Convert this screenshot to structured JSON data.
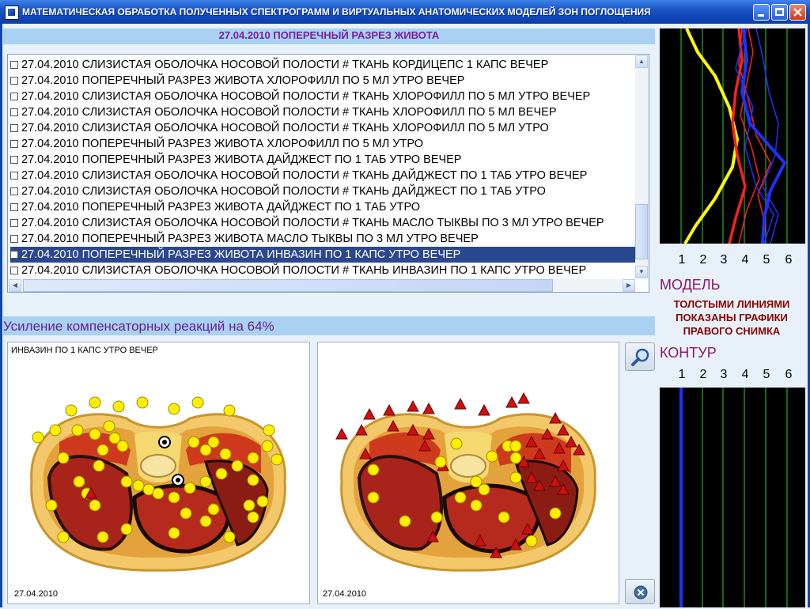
{
  "window": {
    "title": "МАТЕМАТИЧЕСКАЯ ОБРАБОТКА ПОЛУЧЕННЫХ СПЕКТРОГРАММ И ВИРТУАЛЬНЫХ АНАТОМИЧЕСКИХ МОДЕЛЕЙ ЗОН ПОГЛОЩЕНИЯ"
  },
  "header": {
    "title": "27.04.2010 ПОПЕРЕЧНЫЙ РАЗРЕЗ ЖИВОТА"
  },
  "list": {
    "items": [
      {
        "text": "27.04.2010  СЛИЗИСТАЯ  ОБОЛОЧКА  НОСОВОЙ  ПОЛОСТИ # ТКАНЬ  КОРДИЦЕПС 1 КАПС   ВЕЧЕР",
        "checked": false,
        "selected": false
      },
      {
        "text": "27.04.2010  ПОПЕРЕЧНЫЙ  РАЗРЕЗ ЖИВОТА  ХЛОРОФИЛЛ ПО 5 МЛ УТРО ВЕЧЕР",
        "checked": false,
        "selected": false
      },
      {
        "text": "27.04.2010  СЛИЗИСТАЯ  ОБОЛОЧКА  НОСОВОЙ  ПОЛОСТИ # ТКАНЬ  ХЛОРОФИЛЛ ПО 5 МЛ УТРО ВЕЧЕР",
        "checked": false,
        "selected": false
      },
      {
        "text": "27.04.2010  СЛИЗИСТАЯ  ОБОЛОЧКА  НОСОВОЙ  ПОЛОСТИ # ТКАНЬ  ХЛОРОФИЛЛ ПО 5 МЛ   ВЕЧЕР",
        "checked": false,
        "selected": false
      },
      {
        "text": "27.04.2010  СЛИЗИСТАЯ  ОБОЛОЧКА  НОСОВОЙ  ПОЛОСТИ # ТКАНЬ  ХЛОРОФИЛЛ ПО 5 МЛ УТРО",
        "checked": false,
        "selected": false
      },
      {
        "text": "27.04.2010  ПОПЕРЕЧНЫЙ  РАЗРЕЗ ЖИВОТА  ХЛОРОФИЛЛ ПО 5 МЛ УТРО",
        "checked": false,
        "selected": false
      },
      {
        "text": "27.04.2010  ПОПЕРЕЧНЫЙ  РАЗРЕЗ ЖИВОТА  ДАЙДЖЕСТ ПО 1 ТАБ УТРО ВЕЧЕР",
        "checked": false,
        "selected": false
      },
      {
        "text": "27.04.2010  СЛИЗИСТАЯ  ОБОЛОЧКА  НОСОВОЙ  ПОЛОСТИ # ТКАНЬ  ДАЙДЖЕСТ ПО 1 ТАБ УТРО ВЕЧЕР",
        "checked": false,
        "selected": false
      },
      {
        "text": "27.04.2010  СЛИЗИСТАЯ  ОБОЛОЧКА  НОСОВОЙ  ПОЛОСТИ # ТКАНЬ  ДАЙДЖЕСТ ПО 1 ТАБ УТРО",
        "checked": false,
        "selected": false
      },
      {
        "text": "27.04.2010  ПОПЕРЕЧНЫЙ  РАЗРЕЗ ЖИВОТА  ДАЙДЖЕСТ ПО 1 ТАБ УТРО",
        "checked": false,
        "selected": false
      },
      {
        "text": "27.04.2010  СЛИЗИСТАЯ  ОБОЛОЧКА  НОСОВОЙ  ПОЛОСТИ # ТКАНЬ  МАСЛО ТЫКВЫ ПО 3 МЛ УТРО ВЕЧЕР",
        "checked": false,
        "selected": false
      },
      {
        "text": "27.04.2010  ПОПЕРЕЧНЫЙ  РАЗРЕЗ ЖИВОТА  МАСЛО ТЫКВЫ ПО 3 МЛ УТРО ВЕЧЕР",
        "checked": false,
        "selected": false
      },
      {
        "text": "27.04.2010  ПОПЕРЕЧНЫЙ  РАЗРЕЗ ЖИВОТА  ИНВАЗИН ПО 1 КАПС УТРО ВЕЧЕР",
        "checked": false,
        "selected": true
      },
      {
        "text": "27.04.2010  СЛИЗИСТАЯ  ОБОЛОЧКА  НОСОВОЙ  ПОЛОСТИ # ТКАНЬ  ИНВАЗИН ПО 1 КАПС УТРО ВЕЧЕР",
        "checked": false,
        "selected": false
      }
    ]
  },
  "enhancement": {
    "text": "Усиление компенсаторных реакций на 64%"
  },
  "left_panel": {
    "caption": "ИНВАЗИН ПО 1 КАПС УТРО ВЕЧЕР",
    "date": "27.04.2010"
  },
  "right_panel": {
    "date": "27.04.2010"
  },
  "model": {
    "label": "МОДЕЛЬ",
    "note_lines": [
      "ТОЛСТЫМИ ЛИНИЯМИ",
      "ПОКАЗАНЫ ГРАФИКИ",
      "ПРАВОГО СНИМКА"
    ],
    "axis_numbers": [
      "1",
      "2",
      "3",
      "4",
      "5",
      "6"
    ]
  },
  "contour": {
    "label": "КОНТУР",
    "axis_numbers": [
      "1",
      "2",
      "3",
      "4",
      "5",
      "6"
    ]
  },
  "icons": {
    "zoom": "magnifier-icon",
    "close_round": "close-circle-icon",
    "app": "app-icon"
  },
  "colors": {
    "title_bar": "#0e44b6",
    "header_bg": "#a9d2f2",
    "header_text": "#7a1ea0",
    "selected_row": "#2b4790",
    "label_purple": "#8b1a6b",
    "note_red": "#8b0000",
    "chart_bg": "#000000",
    "chart_grid": "#1f8a1f",
    "series_yellow": "#ffff00",
    "series_red": "#ff2020",
    "series_blue": "#2030ff",
    "marker_yellow": "#ffee00",
    "marker_red": "#cc1010"
  }
}
